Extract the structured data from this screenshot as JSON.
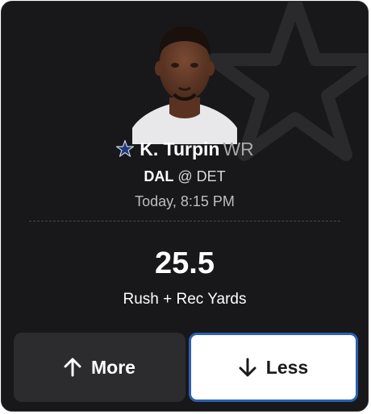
{
  "player": {
    "name": "K. Turpin",
    "position": "WR",
    "team_icon": "cowboys-star-icon",
    "photo": "player-headshot"
  },
  "game": {
    "team": "DAL",
    "opponent_text": "@ DET",
    "time": "Today, 8:15 PM"
  },
  "projection": {
    "line": "25.5",
    "stat": "Rush + Rec Yards"
  },
  "actions": {
    "more_label": "More",
    "less_label": "Less",
    "more_icon": "arrow-up-icon",
    "less_icon": "arrow-down-icon"
  },
  "colors": {
    "card_bg": "#18181a",
    "more_bg": "#2c2c2f",
    "less_bg": "#ffffff",
    "less_border": "#2b5fb3",
    "team_star": "#1e3a78"
  }
}
